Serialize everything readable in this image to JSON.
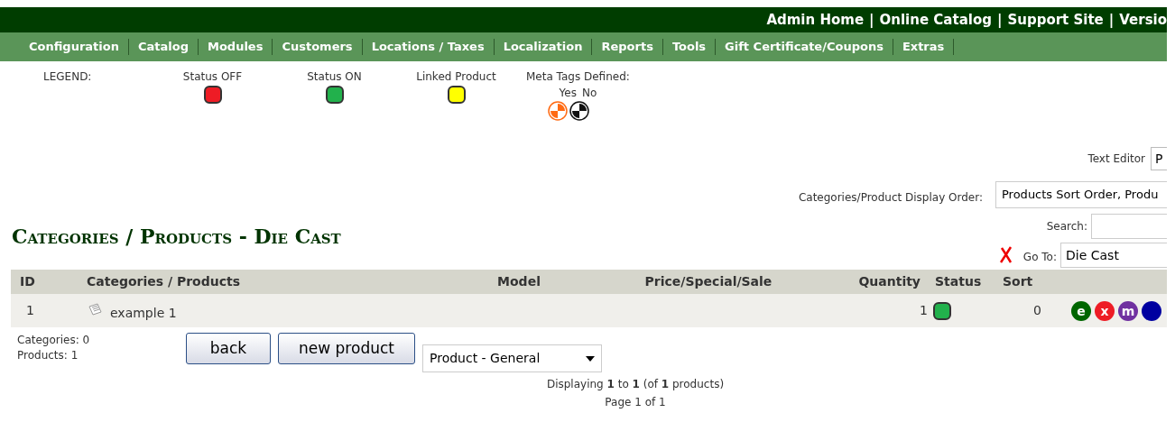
{
  "top_links": [
    "Admin Home",
    "Online Catalog",
    "Support Site",
    "Versio"
  ],
  "top_separator": "|",
  "nav": [
    "Configuration",
    "Catalog",
    "Modules",
    "Customers",
    "Locations / Taxes",
    "Localization",
    "Reports",
    "Tools",
    "Gift Certificate/Coupons",
    "Extras"
  ],
  "legend": {
    "label": "LEGEND:",
    "items": [
      {
        "label": "Status OFF",
        "color": "#ee1c25"
      },
      {
        "label": "Status ON",
        "color": "#22b14c"
      },
      {
        "label": "Linked Product",
        "color": "#ffff00"
      }
    ],
    "meta": {
      "label": "Meta Tags Defined:",
      "yes": "Yes",
      "no": "No"
    }
  },
  "text_editor": {
    "label": "Text Editor",
    "value": "P"
  },
  "display_order": {
    "label": "Categories/Product Display Order:",
    "value": "Products Sort Order, Produ"
  },
  "search": {
    "label": "Search:"
  },
  "goto": {
    "label": "Go To:",
    "value": "Die Cast"
  },
  "heading": "Categories / Products - Die Cast",
  "table": {
    "columns": [
      "ID",
      "Categories / Products",
      "Model",
      "Price/Special/Sale",
      "Quantity",
      "Status",
      "Sort"
    ],
    "rows": [
      {
        "id": "1",
        "name": "example 1",
        "quantity": "1",
        "on": true,
        "sort": "0",
        "actions": [
          {
            "label": "e",
            "color": "#006600"
          },
          {
            "label": "x",
            "color": "#ee1c25"
          },
          {
            "label": "m",
            "color": "#7030a0"
          },
          {
            "color": "#0000a0"
          }
        ]
      }
    ]
  },
  "counts": [
    "Categories: 0",
    "Products: 1"
  ],
  "buttons": [
    "back",
    "new product"
  ],
  "product_type": "Product - General",
  "displaying": "Displaying **1** to **1** (of **1** products)",
  "page": "Page 1 of 1"
}
